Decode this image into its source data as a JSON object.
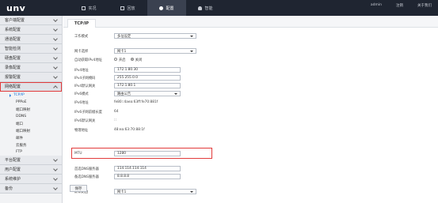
{
  "topbar": {
    "logo": "unv",
    "nav": [
      {
        "label": "实况",
        "icon": "monitor-icon"
      },
      {
        "label": "回放",
        "icon": "playback-icon"
      },
      {
        "label": "配置",
        "icon": "settings-icon",
        "active": true
      },
      {
        "label": "智能",
        "icon": "smart-icon"
      }
    ],
    "user": "admin",
    "logout": "注销",
    "about": "关于我们"
  },
  "sidebar": {
    "groups_before": [
      {
        "label": "客户端配置"
      },
      {
        "label": "系统配置"
      },
      {
        "label": "通道配置"
      },
      {
        "label": "智能检测"
      },
      {
        "label": "硬盘配置"
      },
      {
        "label": "录像配置"
      },
      {
        "label": "报警配置"
      }
    ],
    "network": {
      "label": "网络配置",
      "items": [
        "TCP/IP",
        "PPPoE",
        "端口映射",
        "DDNS",
        "端口",
        "端口映射",
        "邮件",
        "云服务",
        "FTP"
      ]
    },
    "groups_after": [
      {
        "label": "平台配置"
      },
      {
        "label": "用户配置"
      },
      {
        "label": "系统维护"
      },
      {
        "label": "备份"
      }
    ]
  },
  "main": {
    "tab": "TCP/IP",
    "fields": {
      "work_mode": {
        "label": "工作模式",
        "value": "多址设定"
      },
      "nic": {
        "label": "网卡选择",
        "value": "网卡1"
      },
      "dhcp": {
        "label": "自动获取IPv4地址",
        "off": "开启",
        "on": "关闭"
      },
      "ipv4": {
        "label": "IPv4地址",
        "value": "172.1.80.30"
      },
      "mask": {
        "label": "IPv4子网掩码",
        "value": "255.255.0.0"
      },
      "gateway": {
        "label": "IPv4默认网关",
        "value": "172.1.80.1"
      },
      "ipv6_mode": {
        "label": "IPv6模式",
        "value": "路由公告"
      },
      "ipv6_addr": {
        "label": "IPv6地址",
        "value": "fe80::4aea:63ff:fe70:881f"
      },
      "ipv6_prefix": {
        "label": "IPv6子网前缀长度",
        "value": "64"
      },
      "ipv6_gw": {
        "label": "IPv6默认网关",
        "value": "::"
      },
      "mac": {
        "label": "物理地址",
        "value": "48:ea:63:70:88:1f"
      },
      "mtu": {
        "label": "MTU",
        "value": "1280"
      },
      "dns1": {
        "label": "首选DNS服务器",
        "value": "114.114.114.114"
      },
      "dns2": {
        "label": "备选DNS服务器",
        "value": "8.8.8.8"
      },
      "default_route": {
        "label": "默认路由",
        "value": "网卡1"
      }
    },
    "save": "保存"
  }
}
